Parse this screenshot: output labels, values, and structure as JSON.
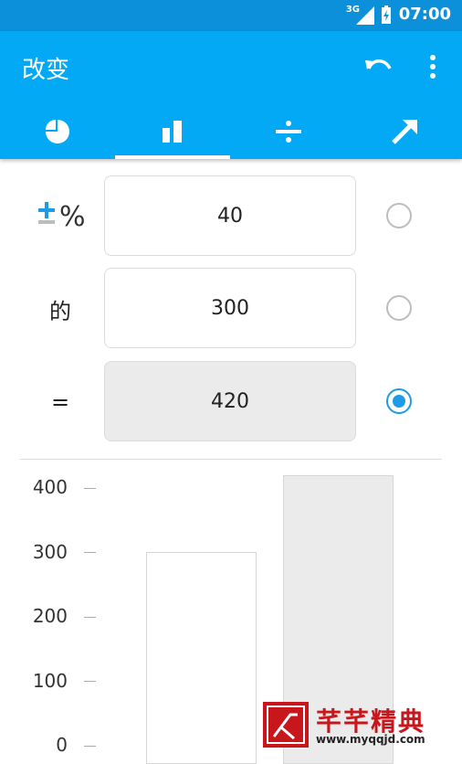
{
  "status_bar": {
    "network": "3G",
    "time": "07:00"
  },
  "app_bar": {
    "title": "改变"
  },
  "tabs": [
    {
      "name": "pie",
      "selected": false
    },
    {
      "name": "bar",
      "selected": true
    },
    {
      "name": "divide",
      "selected": false
    },
    {
      "name": "trend",
      "selected": false
    }
  ],
  "form": {
    "percent": {
      "label": "±%",
      "value": "40",
      "selected": false
    },
    "of": {
      "label": "的",
      "value": "300",
      "selected": false
    },
    "result": {
      "label": "=",
      "value": "420",
      "selected": true
    }
  },
  "chart_data": {
    "type": "bar",
    "categories": [
      "",
      ""
    ],
    "values": [
      300,
      420
    ],
    "ylim": [
      0,
      420
    ],
    "yticks": [
      "400",
      "300",
      "200",
      "100",
      "0"
    ],
    "colors": [
      "#ffffff",
      "#ebebeb"
    ]
  },
  "watermark": {
    "brand": "芊芊精典",
    "url": "www.myqqjd.com"
  },
  "colors": {
    "primary": "#03a9f4",
    "status": "#0c90d9",
    "accent": "#1e9be8"
  }
}
